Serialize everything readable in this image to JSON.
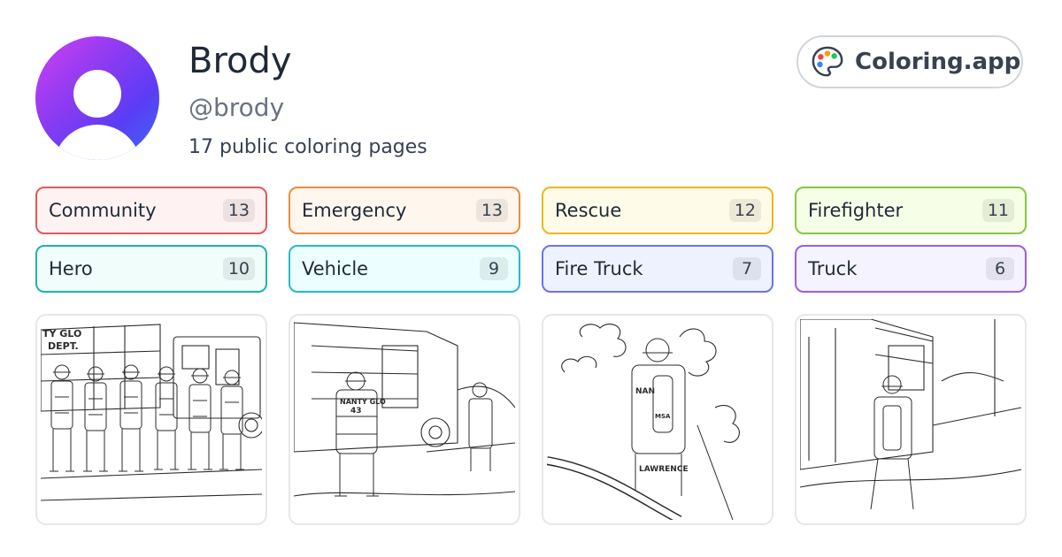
{
  "profile": {
    "name": "Brody",
    "handle": "@brody",
    "count_text": "17 public coloring pages"
  },
  "brand": {
    "label": "Coloring.app",
    "icon": "palette-icon"
  },
  "tags": [
    {
      "label": "Community",
      "count": "13",
      "border": "#e05a5a",
      "bg": "#fef2f2"
    },
    {
      "label": "Emergency",
      "count": "13",
      "border": "#ef8a3b",
      "bg": "#fff7ed"
    },
    {
      "label": "Rescue",
      "count": "12",
      "border": "#e8b820",
      "bg": "#fefce8"
    },
    {
      "label": "Firefighter",
      "count": "11",
      "border": "#84c93a",
      "bg": "#f7fee7"
    },
    {
      "label": "Hero",
      "count": "10",
      "border": "#1fb3ab",
      "bg": "#f0fdfa"
    },
    {
      "label": "Vehicle",
      "count": "9",
      "border": "#28b9cc",
      "bg": "#ecfeff"
    },
    {
      "label": "Fire Truck",
      "count": "7",
      "border": "#6b73e8",
      "bg": "#eef2ff"
    },
    {
      "label": "Truck",
      "count": "6",
      "border": "#9a5ee6",
      "bg": "#f5f3ff"
    }
  ],
  "cards": [
    {
      "texts": [
        "TY GLO",
        "DEPT."
      ]
    },
    {
      "texts": [
        "NANTY GLO",
        "43"
      ]
    },
    {
      "texts": [
        "NAN",
        "MSA",
        "LAWRENCE"
      ]
    },
    {
      "texts": []
    }
  ]
}
